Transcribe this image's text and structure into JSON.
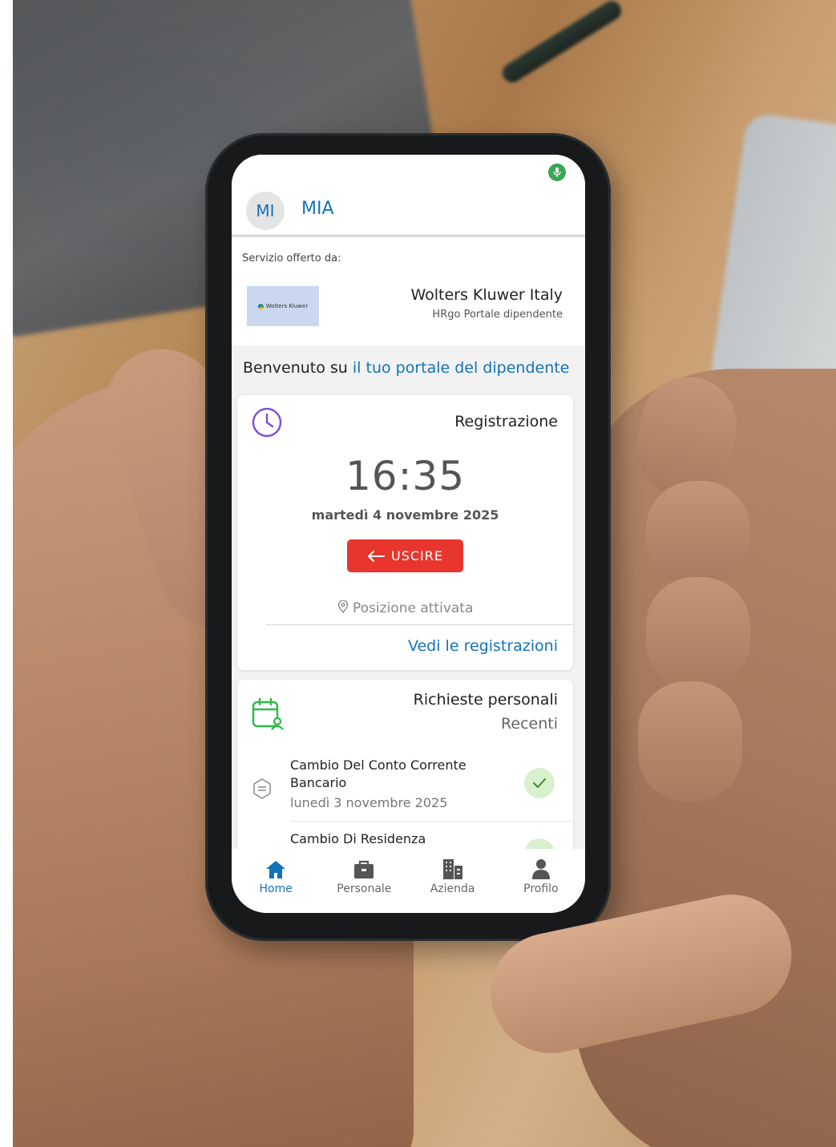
{
  "app": {
    "user_initials": "MI",
    "user_name": "MIA",
    "mic_icon": "microphone-icon"
  },
  "provider": {
    "caption": "Servizio offerto da:",
    "logo_text": "Wolters Kluwer",
    "name": "Wolters Kluwer Italy",
    "subtitle": "HRgo Portale dipendente"
  },
  "welcome": {
    "prefix": "Benvenuto su ",
    "highlight": "il tuo portale del dipendente"
  },
  "registration": {
    "title": "Registrazione",
    "time": "16:35",
    "date": "martedì 4 novembre 2025",
    "exit_label": "USCIRE",
    "location": "Posizione attivata",
    "view_link": "Vedi le registrazioni"
  },
  "requests": {
    "title": "Richieste personali",
    "subtitle": "Recenti",
    "items": [
      {
        "name": "Cambio Del Conto Corrente Bancario",
        "date": "lunedì 3 novembre 2025",
        "status": "approved"
      },
      {
        "name": "Cambio Di Residenza",
        "date": "",
        "status": "approved"
      }
    ]
  },
  "nav": {
    "items": [
      {
        "label": "Home",
        "icon": "home-icon",
        "active": true
      },
      {
        "label": "Personale",
        "icon": "briefcase-icon",
        "active": false
      },
      {
        "label": "Azienda",
        "icon": "building-icon",
        "active": false
      },
      {
        "label": "Profilo",
        "icon": "person-icon",
        "active": false
      }
    ]
  },
  "colors": {
    "accent": "#1273b8",
    "exit_button": "#e8362f",
    "status_ok": "#d9f0cf",
    "mic": "#36a852"
  }
}
